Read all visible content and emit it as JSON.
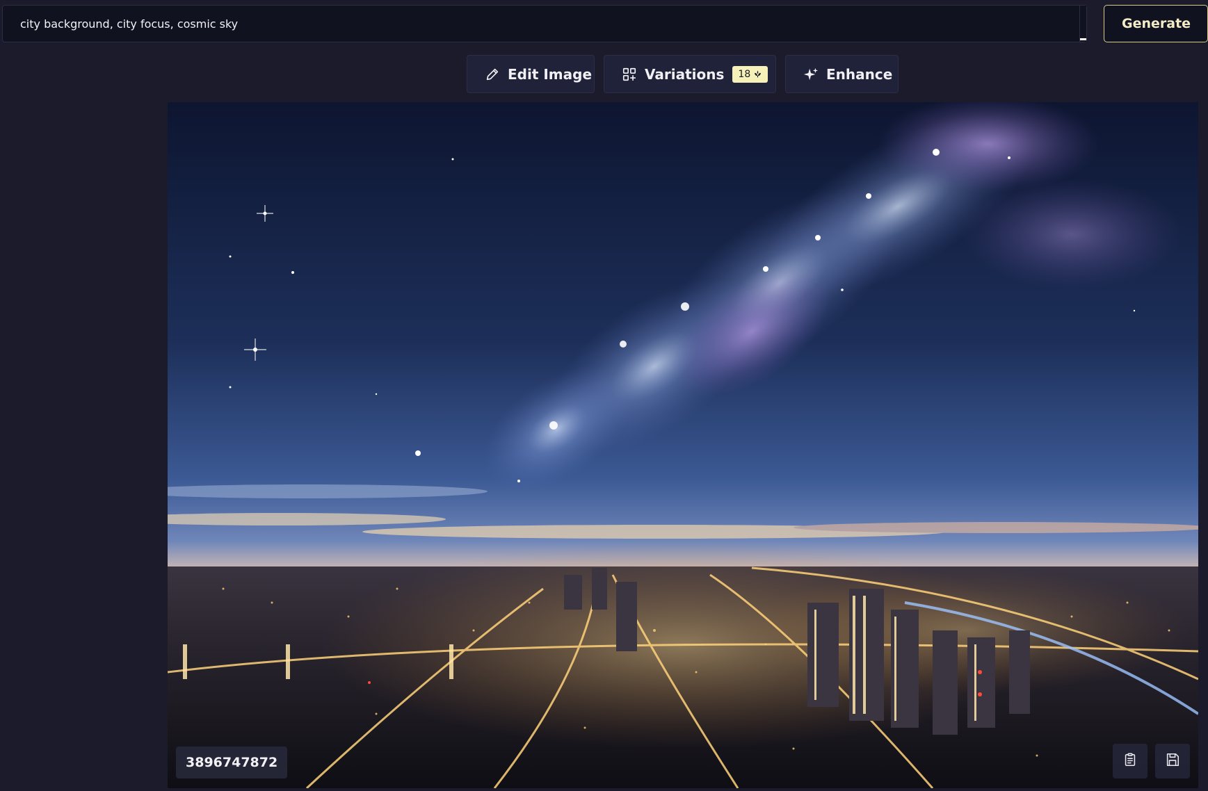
{
  "prompt": {
    "value": "city background, city focus, cosmic sky"
  },
  "generate": {
    "label": "Generate"
  },
  "actions": {
    "edit_label": "Edit Image",
    "variations_label": "Variations",
    "variations_cost": "18",
    "enhance_label": "Enhance"
  },
  "image": {
    "seed": "3896747872"
  },
  "icons": {
    "edit": "pencil-icon",
    "variations": "grid-plus-icon",
    "enhance": "sparkle-icon",
    "credit": "coin-icon",
    "copy": "clipboard-icon",
    "save": "floppy-disk-icon"
  },
  "colors": {
    "background": "#1b1b2b",
    "accent": "#f6f1b8",
    "button_bg": "#20223a"
  }
}
